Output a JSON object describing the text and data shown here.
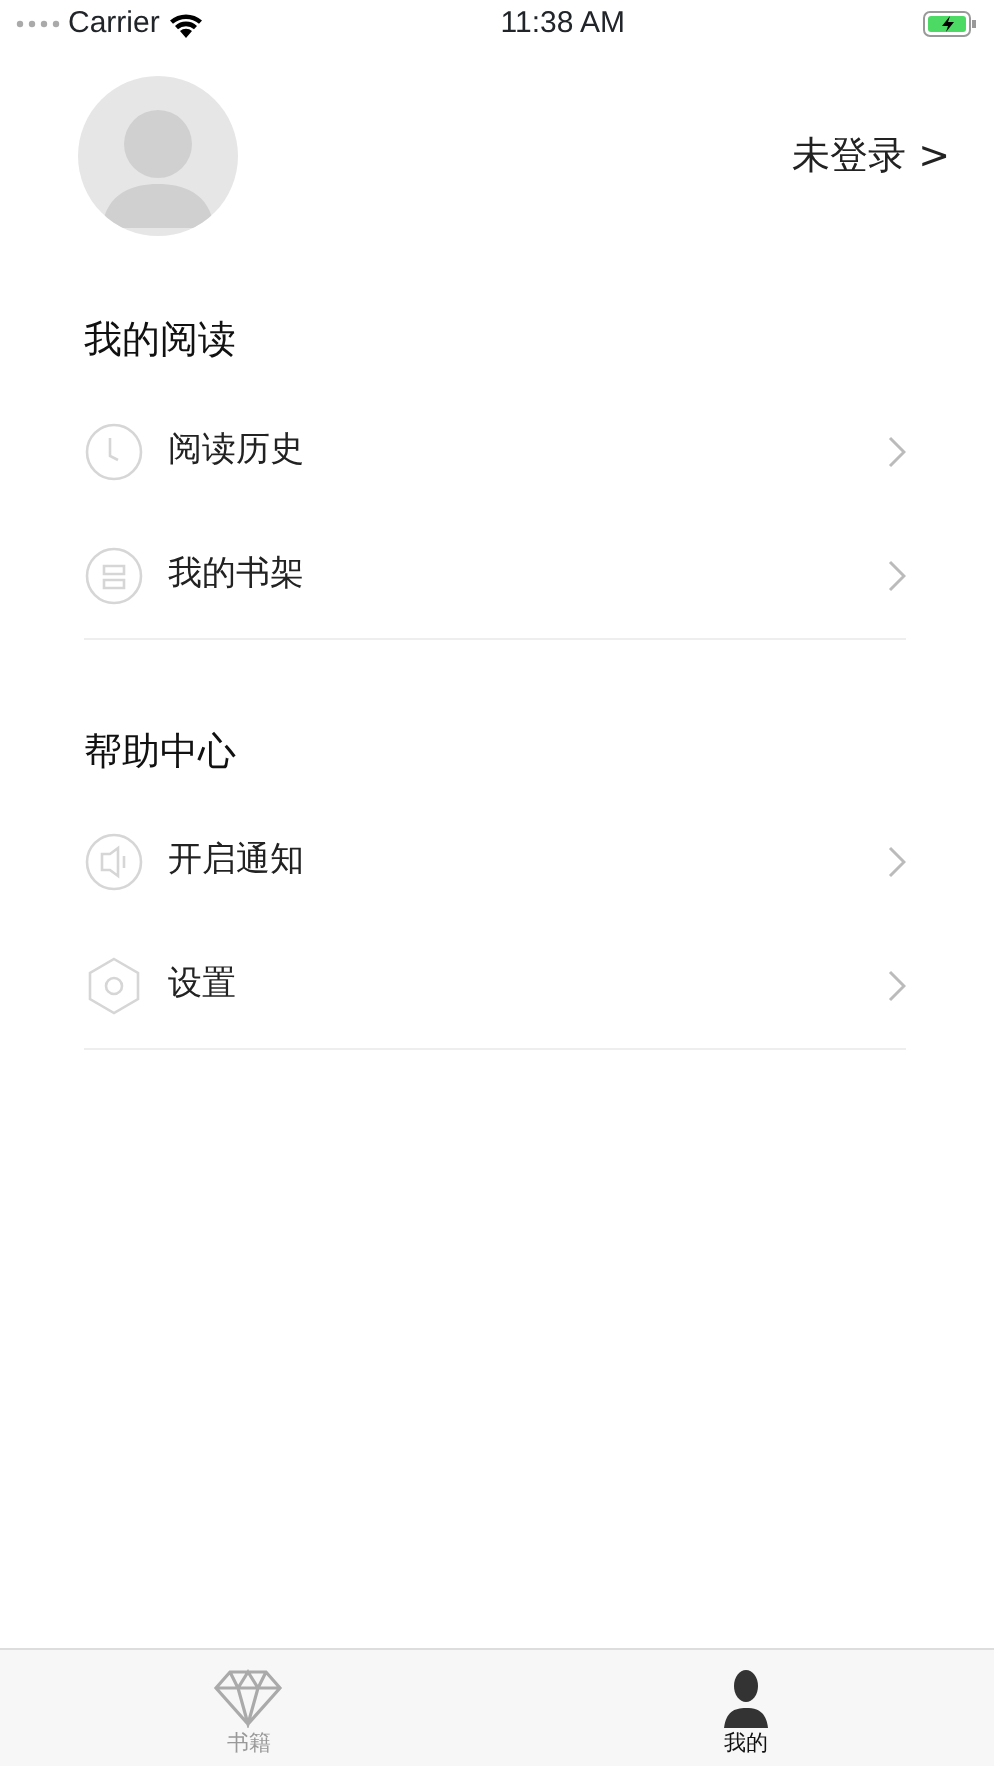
{
  "status_bar": {
    "carrier": "Carrier",
    "time": "11:38 AM",
    "battery_charging": true
  },
  "profile": {
    "login_label": "未登录 >"
  },
  "sections": [
    {
      "title": "我的阅读",
      "items": [
        {
          "label": "阅读历史",
          "kind": "clock"
        },
        {
          "label": "我的书架",
          "kind": "shelf"
        }
      ]
    },
    {
      "title": "帮助中心",
      "items": [
        {
          "label": "开启通知",
          "kind": "speaker"
        },
        {
          "label": "设置",
          "kind": "hexagon"
        }
      ]
    }
  ],
  "tab_bar": [
    {
      "label": "书籍",
      "kind": "diamond",
      "selected": false
    },
    {
      "label": "我的",
      "kind": "person",
      "selected": true
    }
  ]
}
